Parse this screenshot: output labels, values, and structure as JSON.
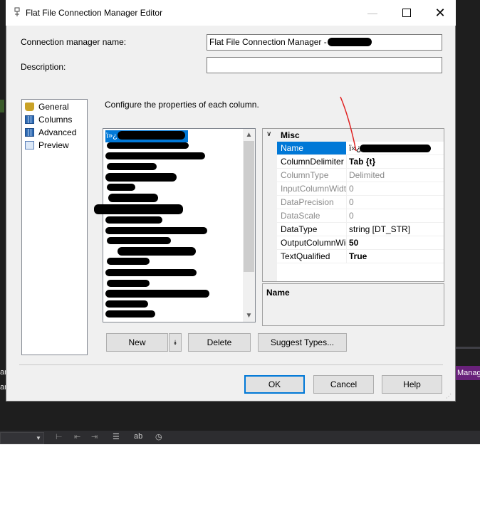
{
  "ide": {
    "left_text_1": "an",
    "left_text_2": "ar",
    "right_tab_label": "Manag"
  },
  "dialog": {
    "title": "Flat File Connection Manager Editor",
    "connection_manager_name_label": "Connection manager name:",
    "connection_manager_name_value": "Flat File Connection Manager - ",
    "description_label": "Description:",
    "description_value": "",
    "instruction": "Configure the properties of each column."
  },
  "nav": {
    "items": [
      {
        "label": "General",
        "icon": "general-icon"
      },
      {
        "label": "Columns",
        "icon": "columns-icon"
      },
      {
        "label": "Advanced",
        "icon": "advanced-icon"
      },
      {
        "label": "Preview",
        "icon": "preview-icon"
      }
    ]
  },
  "column_list": {
    "selected_prefix": "ï»¿"
  },
  "property_grid": {
    "category": "Misc",
    "rows": [
      {
        "name": "Name",
        "value": "ï»¿"
      },
      {
        "name": "ColumnDelimiter",
        "value": "Tab {t}"
      },
      {
        "name": "ColumnType",
        "value": "Delimited"
      },
      {
        "name": "InputColumnWidth",
        "value": "0"
      },
      {
        "name": "DataPrecision",
        "value": "0"
      },
      {
        "name": "DataScale",
        "value": "0"
      },
      {
        "name": "DataType",
        "value": "string [DT_STR]"
      },
      {
        "name": "OutputColumnWidth",
        "value": "50"
      },
      {
        "name": "TextQualified",
        "value": "True"
      }
    ],
    "description_title": "Name"
  },
  "buttons": {
    "new": "New",
    "delete": "Delete",
    "suggest_types": "Suggest Types...",
    "ok": "OK",
    "cancel": "Cancel",
    "help": "Help"
  }
}
